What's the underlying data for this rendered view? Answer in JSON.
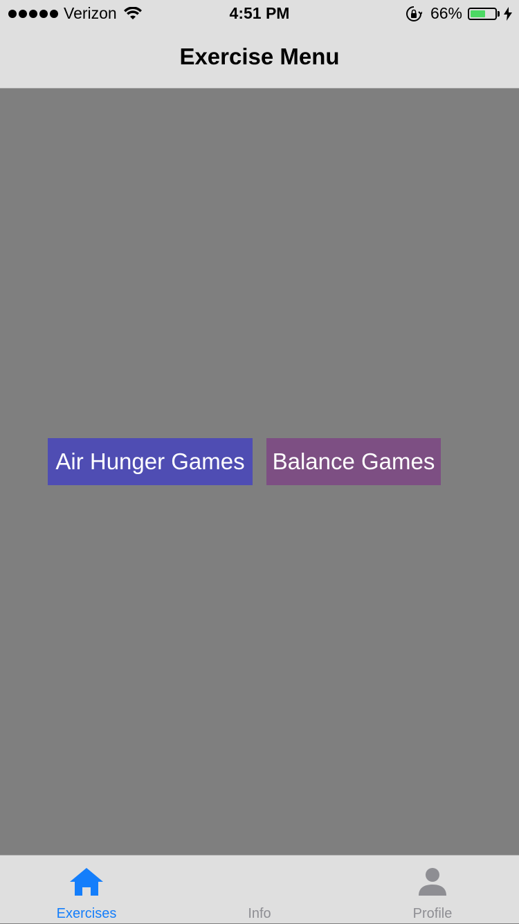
{
  "status_bar": {
    "carrier": "Verizon",
    "time": "4:51 PM",
    "battery": "66%",
    "battery_level": 0.66,
    "battery_color": "#4cd964"
  },
  "nav": {
    "title": "Exercise Menu"
  },
  "buttons": {
    "air_hunger": {
      "label": "Air Hunger Games",
      "color": "#4f4db3"
    },
    "balance": {
      "label": "Balance Games",
      "color": "#7d4f83"
    }
  },
  "tabs": [
    {
      "label": "Exercises",
      "icon": "home-icon",
      "active": true,
      "color": "#147efb"
    },
    {
      "label": "Info",
      "icon": "",
      "active": false,
      "color": "#8e8e93"
    },
    {
      "label": "Profile",
      "icon": "person-icon",
      "active": false,
      "color": "#8e8e93"
    }
  ],
  "colors": {
    "background": "#7f7f7f",
    "bar_background": "#dfdfdf"
  }
}
